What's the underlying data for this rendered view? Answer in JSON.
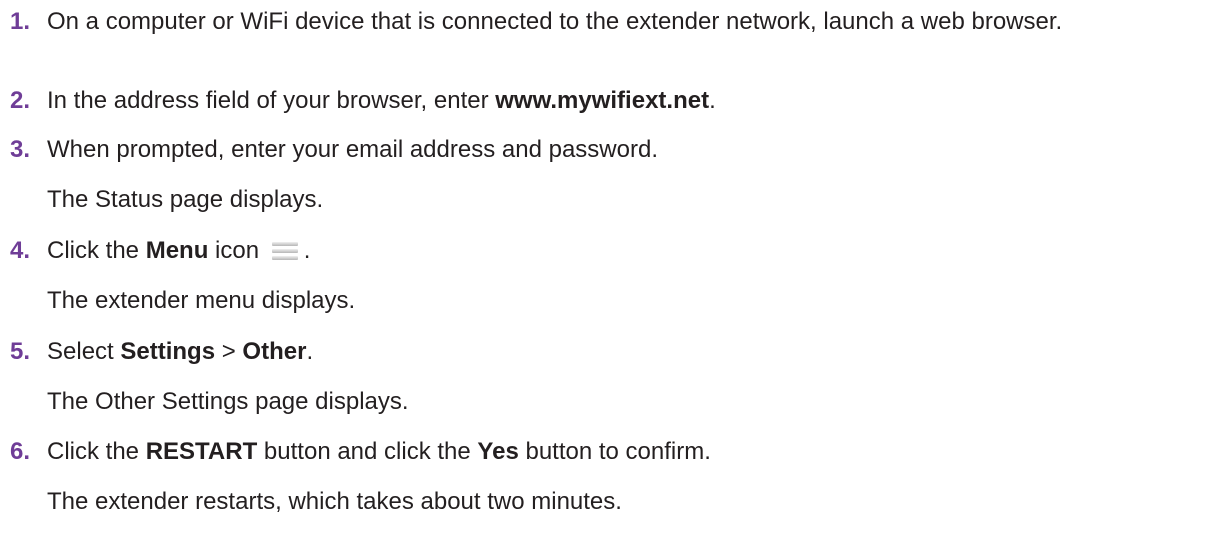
{
  "steps": [
    {
      "num": "1.",
      "text": "On a computer or WiFi device that is connected to the extender network, launch a web browser."
    },
    {
      "num": "2.",
      "pre": "In the address field of your browser, enter ",
      "bold": "www.mywifiext.net",
      "post": "."
    },
    {
      "num": "3.",
      "text": "When prompted, enter your email address and password.",
      "result": "The Status page displays."
    },
    {
      "num": "4.",
      "pre": "Click the ",
      "bold": "Menu",
      "mid": " icon ",
      "icon": "menu-icon",
      "post": ".",
      "result": "The extender menu displays."
    },
    {
      "num": "5.",
      "pre": "Select ",
      "bold1": "Settings",
      "sep": " > ",
      "bold2": "Other",
      "post": ".",
      "result": "The Other Settings page displays."
    },
    {
      "num": "6.",
      "pre": "Click the ",
      "bold1": "RESTART",
      "mid": " button and click the ",
      "bold2": "Yes",
      "post": " button to confirm.",
      "result": "The extender restarts, which takes about two minutes."
    }
  ],
  "colors": {
    "step_number": "#6f3d97",
    "body_text": "#231f20"
  }
}
